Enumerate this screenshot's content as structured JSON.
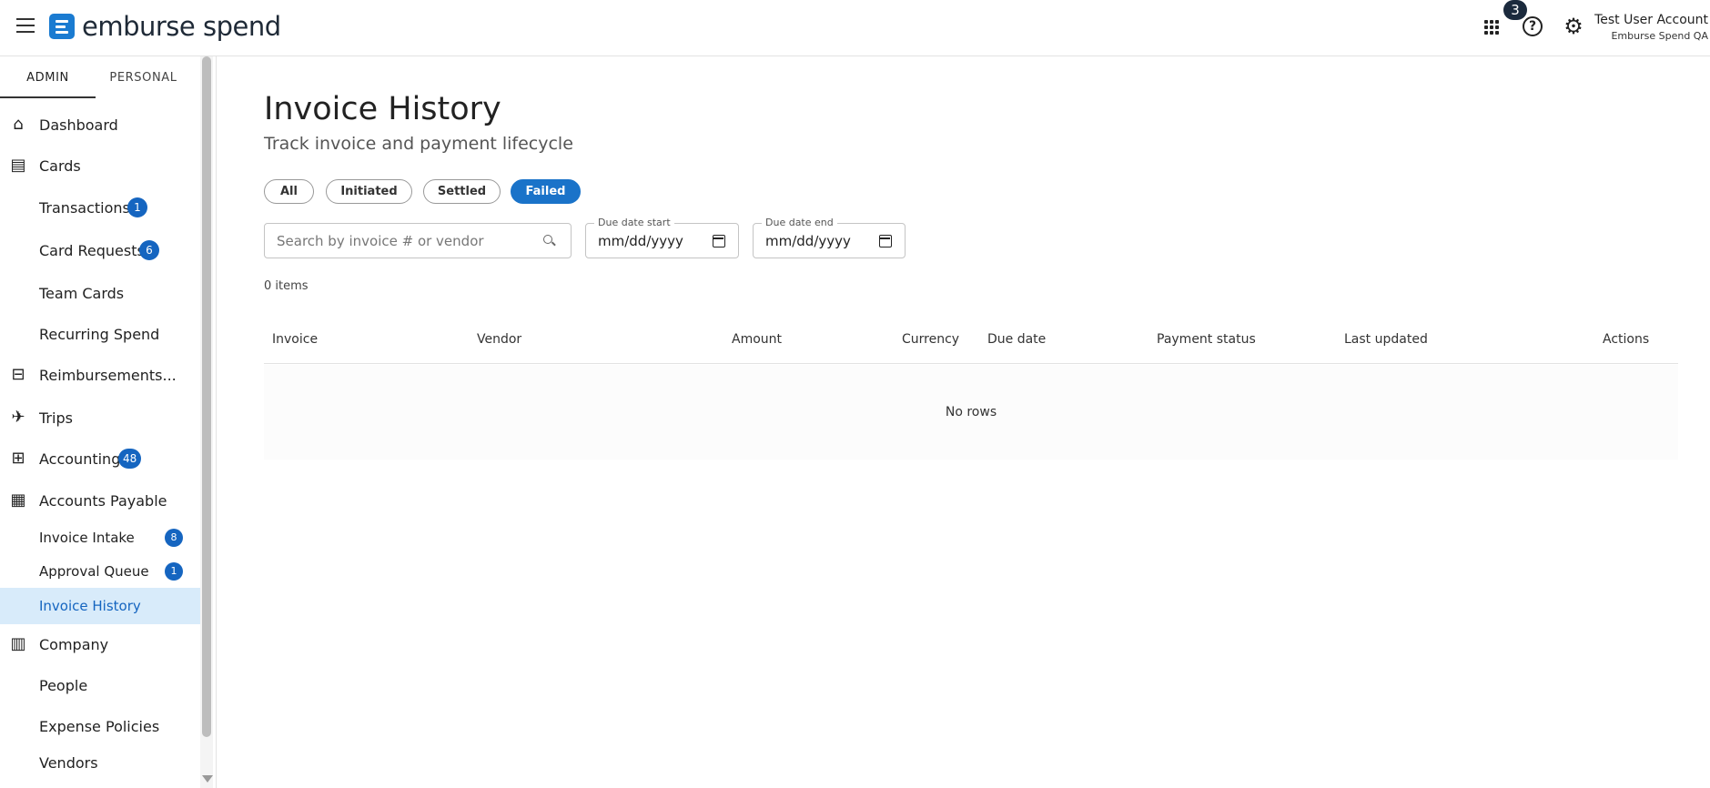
{
  "header": {
    "logo_text": "emburse spend",
    "notification_count": "3",
    "help_icon": "help-circle-icon",
    "settings_icon": "gear-icon",
    "user_name": "Test User Account",
    "user_org": "Emburse Spend QA"
  },
  "sidebar": {
    "tabs": [
      {
        "label": "ADMIN",
        "active": true
      },
      {
        "label": "PERSONAL",
        "active": false
      }
    ],
    "items": [
      {
        "label": "Dashboard",
        "icon": "home-icon"
      },
      {
        "label": "Cards",
        "icon": "cards-icon"
      },
      {
        "label": "Transactions",
        "badge": "1"
      },
      {
        "label": "Card Requests",
        "badge": "6"
      },
      {
        "label": "Team Cards"
      },
      {
        "label": "Recurring Spend"
      },
      {
        "label": "Reimbursements...",
        "icon": "reimbursement-icon"
      },
      {
        "label": "Trips",
        "icon": "airplane-icon"
      },
      {
        "label": "Accounting",
        "icon": "accounting-icon",
        "badge": "48"
      },
      {
        "label": "Accounts Payable",
        "icon": "accounts-payable-icon"
      },
      {
        "label": "Invoice Intake",
        "badge": "8"
      },
      {
        "label": "Approval Queue",
        "badge": "1"
      },
      {
        "label": "Invoice History",
        "selected": true
      },
      {
        "label": "Company",
        "icon": "company-icon"
      },
      {
        "label": "People"
      },
      {
        "label": "Expense Policies"
      },
      {
        "label": "Vendors"
      }
    ]
  },
  "main": {
    "title": "Invoice History",
    "subtitle": "Track invoice and payment lifecycle",
    "filters": [
      {
        "label": "All",
        "active": false
      },
      {
        "label": "Initiated",
        "active": false
      },
      {
        "label": "Settled",
        "active": false
      },
      {
        "label": "Failed",
        "active": true
      }
    ],
    "search_placeholder": "Search by invoice # or vendor",
    "due_date_start": {
      "label": "Due date start",
      "value": "mm/dd/yyyy"
    },
    "due_date_end": {
      "label": "Due date end",
      "value": "mm/dd/yyyy"
    },
    "items_count": "0 items",
    "table": {
      "columns": [
        "Invoice",
        "Vendor",
        "Amount",
        "Currency",
        "Due date",
        "Payment status",
        "Last updated",
        "Actions"
      ],
      "empty_text": "No rows"
    }
  },
  "colors": {
    "accent": "#1a73c9",
    "badge": "#1565c0",
    "selected_bg": "#d8ebfa"
  }
}
